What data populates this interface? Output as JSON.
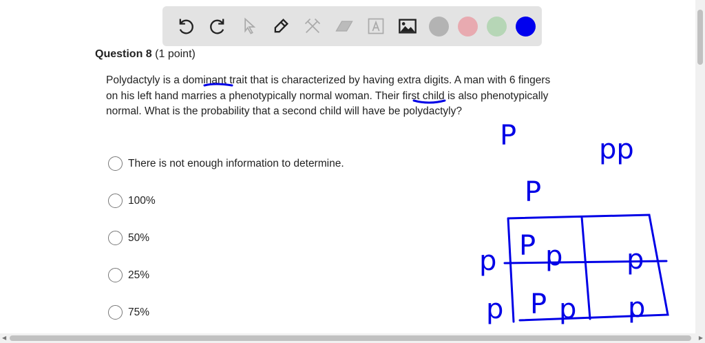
{
  "toolbar": {
    "tools": [
      "undo-icon",
      "redo-icon",
      "select-icon",
      "pen-icon",
      "tools-icon",
      "eraser-icon",
      "text-icon",
      "image-icon"
    ],
    "colors": [
      "#b3b3b3",
      "#e8aab0",
      "#b6d6b6",
      "#0000ee"
    ]
  },
  "question": {
    "title": "Question 8",
    "points": "(1 point)",
    "text": "Polydactyly is a dominant trait that is characterized by having extra digits. A man with 6 fingers on his left hand marries a phenotypically normal woman. Their first child is also phenotypically normal. What is the probability that a second child will have be polydactyly?",
    "options": [
      "There is not enough information to determine.",
      "100%",
      "50%",
      "25%",
      "75%"
    ]
  },
  "annotations": {
    "p1": "P",
    "p2": "pp",
    "p3": "P",
    "r1": "p",
    "r2": "p",
    "c11": "P",
    "c11b": "p",
    "c12": "p",
    "c21": "P",
    "c21b": "p",
    "c22": "p"
  }
}
